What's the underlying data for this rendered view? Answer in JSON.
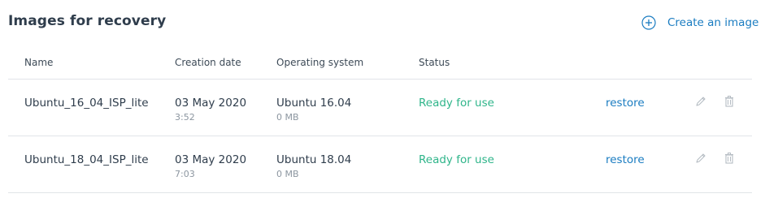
{
  "page": {
    "title": "Images for recovery",
    "create_label": "Create an image"
  },
  "table": {
    "headers": {
      "name": "Name",
      "date": "Creation date",
      "os": "Operating system",
      "status": "Status"
    },
    "rows": [
      {
        "name": "Ubuntu_16_04_ISP_lite",
        "date": "03 May 2020",
        "time": "3:52",
        "os": "Ubuntu 16.04",
        "size": "0 MB",
        "status": "Ready for use",
        "action": "restore"
      },
      {
        "name": "Ubuntu_18_04_ISP_lite",
        "date": "03 May 2020",
        "time": "7:03",
        "os": "Ubuntu 18.04",
        "size": "0 MB",
        "status": "Ready for use",
        "action": "restore"
      }
    ]
  },
  "colors": {
    "accent": "#1a7cc1",
    "status_ready": "#2fb58a",
    "text": "#2f3d4c",
    "muted": "#8c96a0"
  },
  "icons": {
    "create": "plus-circle-icon",
    "edit": "pencil-icon",
    "delete": "trash-icon"
  }
}
